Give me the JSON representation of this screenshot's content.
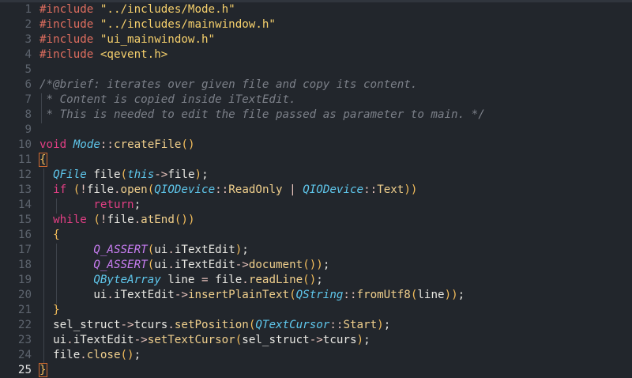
{
  "editor": {
    "active_line": 25,
    "lines": [
      {
        "n": "1",
        "tokens": [
          [
            "pp",
            "#include "
          ],
          [
            "str",
            "\"../includes/Mode.h\""
          ]
        ]
      },
      {
        "n": "2",
        "tokens": [
          [
            "pp",
            "#include "
          ],
          [
            "str",
            "\"../includes/mainwindow.h\""
          ]
        ]
      },
      {
        "n": "3",
        "tokens": [
          [
            "pp",
            "#include "
          ],
          [
            "str",
            "\"ui_mainwindow.h\""
          ]
        ]
      },
      {
        "n": "4",
        "tokens": [
          [
            "pp",
            "#include "
          ],
          [
            "str",
            "<qevent.h>"
          ]
        ]
      },
      {
        "n": "5",
        "tokens": []
      },
      {
        "n": "6",
        "tokens": [
          [
            "cm",
            "/*@brief: iterates over given file and copy its content."
          ]
        ]
      },
      {
        "n": "7",
        "tokens": [
          [
            "cm",
            " * Content is copied inside iTextEdit."
          ]
        ]
      },
      {
        "n": "8",
        "tokens": [
          [
            "cm",
            " * This is needed to edit the file passed as parameter to main. */"
          ]
        ]
      },
      {
        "n": "9",
        "tokens": []
      },
      {
        "n": "10",
        "tokens": [
          [
            "kw",
            "void "
          ],
          [
            "ty",
            "Mode"
          ],
          [
            "op",
            "::"
          ],
          [
            "fn",
            "createFile"
          ],
          [
            "br",
            "()"
          ]
        ]
      },
      {
        "n": "11",
        "tokens": [
          [
            "brhl",
            "{"
          ]
        ]
      },
      {
        "n": "12",
        "tokens": [
          [
            "pl",
            "  "
          ],
          [
            "ty",
            "QFile"
          ],
          [
            "pl",
            " file"
          ],
          [
            "br",
            "("
          ],
          [
            "ty",
            "this"
          ],
          [
            "op",
            "->"
          ],
          [
            "pl",
            "file"
          ],
          [
            "br",
            ")"
          ],
          [
            "pl",
            ";"
          ]
        ]
      },
      {
        "n": "13",
        "tokens": [
          [
            "pl",
            "  "
          ],
          [
            "kw",
            "if"
          ],
          [
            "pl",
            " "
          ],
          [
            "br",
            "("
          ],
          [
            "op",
            "!"
          ],
          [
            "pl",
            "file"
          ],
          [
            "op",
            "."
          ],
          [
            "fn",
            "open"
          ],
          [
            "br",
            "("
          ],
          [
            "ty",
            "QIODevice"
          ],
          [
            "op",
            "::"
          ],
          [
            "fn",
            "ReadOnly"
          ],
          [
            "pl",
            " "
          ],
          [
            "op",
            "|"
          ],
          [
            "pl",
            " "
          ],
          [
            "ty",
            "QIODevice"
          ],
          [
            "op",
            "::"
          ],
          [
            "fn",
            "Text"
          ],
          [
            "br",
            "))"
          ]
        ]
      },
      {
        "n": "14",
        "tokens": [
          [
            "pl",
            "        "
          ],
          [
            "kw",
            "return"
          ],
          [
            "pl",
            ";"
          ]
        ]
      },
      {
        "n": "15",
        "tokens": [
          [
            "pl",
            "  "
          ],
          [
            "kw",
            "while"
          ],
          [
            "pl",
            " "
          ],
          [
            "br",
            "("
          ],
          [
            "op",
            "!"
          ],
          [
            "pl",
            "file"
          ],
          [
            "op",
            "."
          ],
          [
            "fn",
            "atEnd"
          ],
          [
            "br",
            "())"
          ]
        ]
      },
      {
        "n": "16",
        "tokens": [
          [
            "pl",
            "  "
          ],
          [
            "br",
            "{"
          ]
        ]
      },
      {
        "n": "17",
        "tokens": [
          [
            "pl",
            "        "
          ],
          [
            "mac",
            "Q_ASSERT"
          ],
          [
            "br",
            "("
          ],
          [
            "pl",
            "ui"
          ],
          [
            "op",
            "."
          ],
          [
            "pl",
            "iTextEdit"
          ],
          [
            "br",
            ")"
          ],
          [
            "pl",
            ";"
          ]
        ]
      },
      {
        "n": "18",
        "tokens": [
          [
            "pl",
            "        "
          ],
          [
            "mac",
            "Q_ASSERT"
          ],
          [
            "br",
            "("
          ],
          [
            "pl",
            "ui"
          ],
          [
            "op",
            "."
          ],
          [
            "pl",
            "iTextEdit"
          ],
          [
            "op",
            "->"
          ],
          [
            "fn",
            "document"
          ],
          [
            "br",
            "())"
          ],
          [
            "pl",
            ";"
          ]
        ]
      },
      {
        "n": "19",
        "tokens": [
          [
            "pl",
            "        "
          ],
          [
            "ty",
            "QByteArray"
          ],
          [
            "pl",
            " line "
          ],
          [
            "op",
            "="
          ],
          [
            "pl",
            " file"
          ],
          [
            "op",
            "."
          ],
          [
            "fn",
            "readLine"
          ],
          [
            "br",
            "()"
          ],
          [
            "pl",
            ";"
          ]
        ]
      },
      {
        "n": "20",
        "tokens": [
          [
            "pl",
            "        ui"
          ],
          [
            "op",
            "."
          ],
          [
            "pl",
            "iTextEdit"
          ],
          [
            "op",
            "->"
          ],
          [
            "fn",
            "insertPlainText"
          ],
          [
            "br",
            "("
          ],
          [
            "ty",
            "QString"
          ],
          [
            "op",
            "::"
          ],
          [
            "fn",
            "fromUtf8"
          ],
          [
            "br",
            "("
          ],
          [
            "pl",
            "line"
          ],
          [
            "br",
            "))"
          ],
          [
            "pl",
            ";"
          ]
        ]
      },
      {
        "n": "21",
        "tokens": [
          [
            "pl",
            "  "
          ],
          [
            "br",
            "}"
          ]
        ]
      },
      {
        "n": "22",
        "tokens": [
          [
            "pl",
            "  sel_struct"
          ],
          [
            "op",
            "->"
          ],
          [
            "pl",
            "tcurs"
          ],
          [
            "op",
            "."
          ],
          [
            "fn",
            "setPosition"
          ],
          [
            "br",
            "("
          ],
          [
            "ty",
            "QTextCursor"
          ],
          [
            "op",
            "::"
          ],
          [
            "fn",
            "Start"
          ],
          [
            "br",
            ")"
          ],
          [
            "pl",
            ";"
          ]
        ]
      },
      {
        "n": "23",
        "tokens": [
          [
            "pl",
            "  ui"
          ],
          [
            "op",
            "."
          ],
          [
            "pl",
            "iTextEdit"
          ],
          [
            "op",
            "->"
          ],
          [
            "fn",
            "setTextCursor"
          ],
          [
            "br",
            "("
          ],
          [
            "pl",
            "sel_struct"
          ],
          [
            "op",
            "->"
          ],
          [
            "pl",
            "tcurs"
          ],
          [
            "br",
            ")"
          ],
          [
            "pl",
            ";"
          ]
        ]
      },
      {
        "n": "24",
        "tokens": [
          [
            "pl",
            "  file"
          ],
          [
            "op",
            "."
          ],
          [
            "fn",
            "close"
          ],
          [
            "br",
            "()"
          ],
          [
            "pl",
            ";"
          ]
        ]
      },
      {
        "n": "25",
        "tokens": [
          [
            "brhl",
            "}"
          ]
        ]
      }
    ]
  }
}
